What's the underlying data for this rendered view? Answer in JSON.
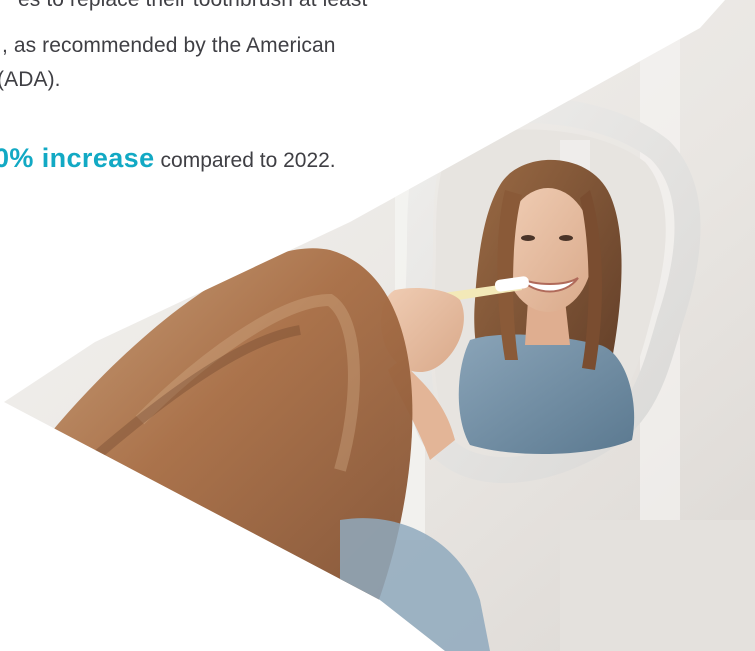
{
  "copy": {
    "line_1": "es to replace their toothbrush at least",
    "line_2": ", as recommended by the American",
    "line_3": "(ADA).",
    "stat_highlight": "0% increase",
    "stat_rest": "compared to 2022."
  },
  "photo": {
    "subject": "woman-brushing-teeth-mirror-reflection",
    "colors": {
      "highlight": "#12a9c4",
      "body_text": "#3f3f44",
      "wall": "#eceae7",
      "shirt": "#6f8fa8",
      "hair": "#b07a4e"
    }
  }
}
